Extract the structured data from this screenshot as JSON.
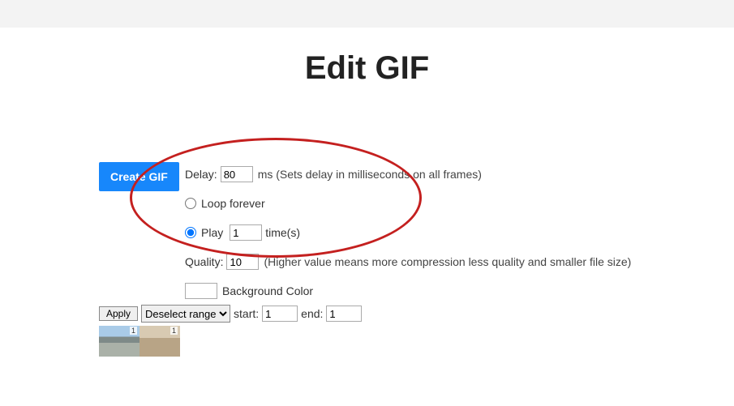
{
  "title": "Edit GIF",
  "buttons": {
    "create": "Create GIF",
    "apply": "Apply"
  },
  "settings": {
    "delay": {
      "label": "Delay:",
      "value": "80",
      "hint": "ms (Sets delay in milliseconds on all frames)"
    },
    "loop": {
      "loop_forever_label": "Loop forever",
      "play_label": "Play",
      "play_value": "1",
      "play_suffix": "time(s)",
      "selected": "play"
    },
    "quality": {
      "label": "Quality:",
      "value": "10",
      "hint": "(Higher value means more compression less quality and smaller file size)"
    },
    "bgcolor": {
      "label": "Background Color",
      "value": "#ffffff"
    }
  },
  "range": {
    "select_label": "Deselect range",
    "start_label": "start:",
    "start_value": "1",
    "end_label": "end:",
    "end_value": "1"
  },
  "thumbs": {
    "idx1": "1",
    "idx2": "1"
  }
}
